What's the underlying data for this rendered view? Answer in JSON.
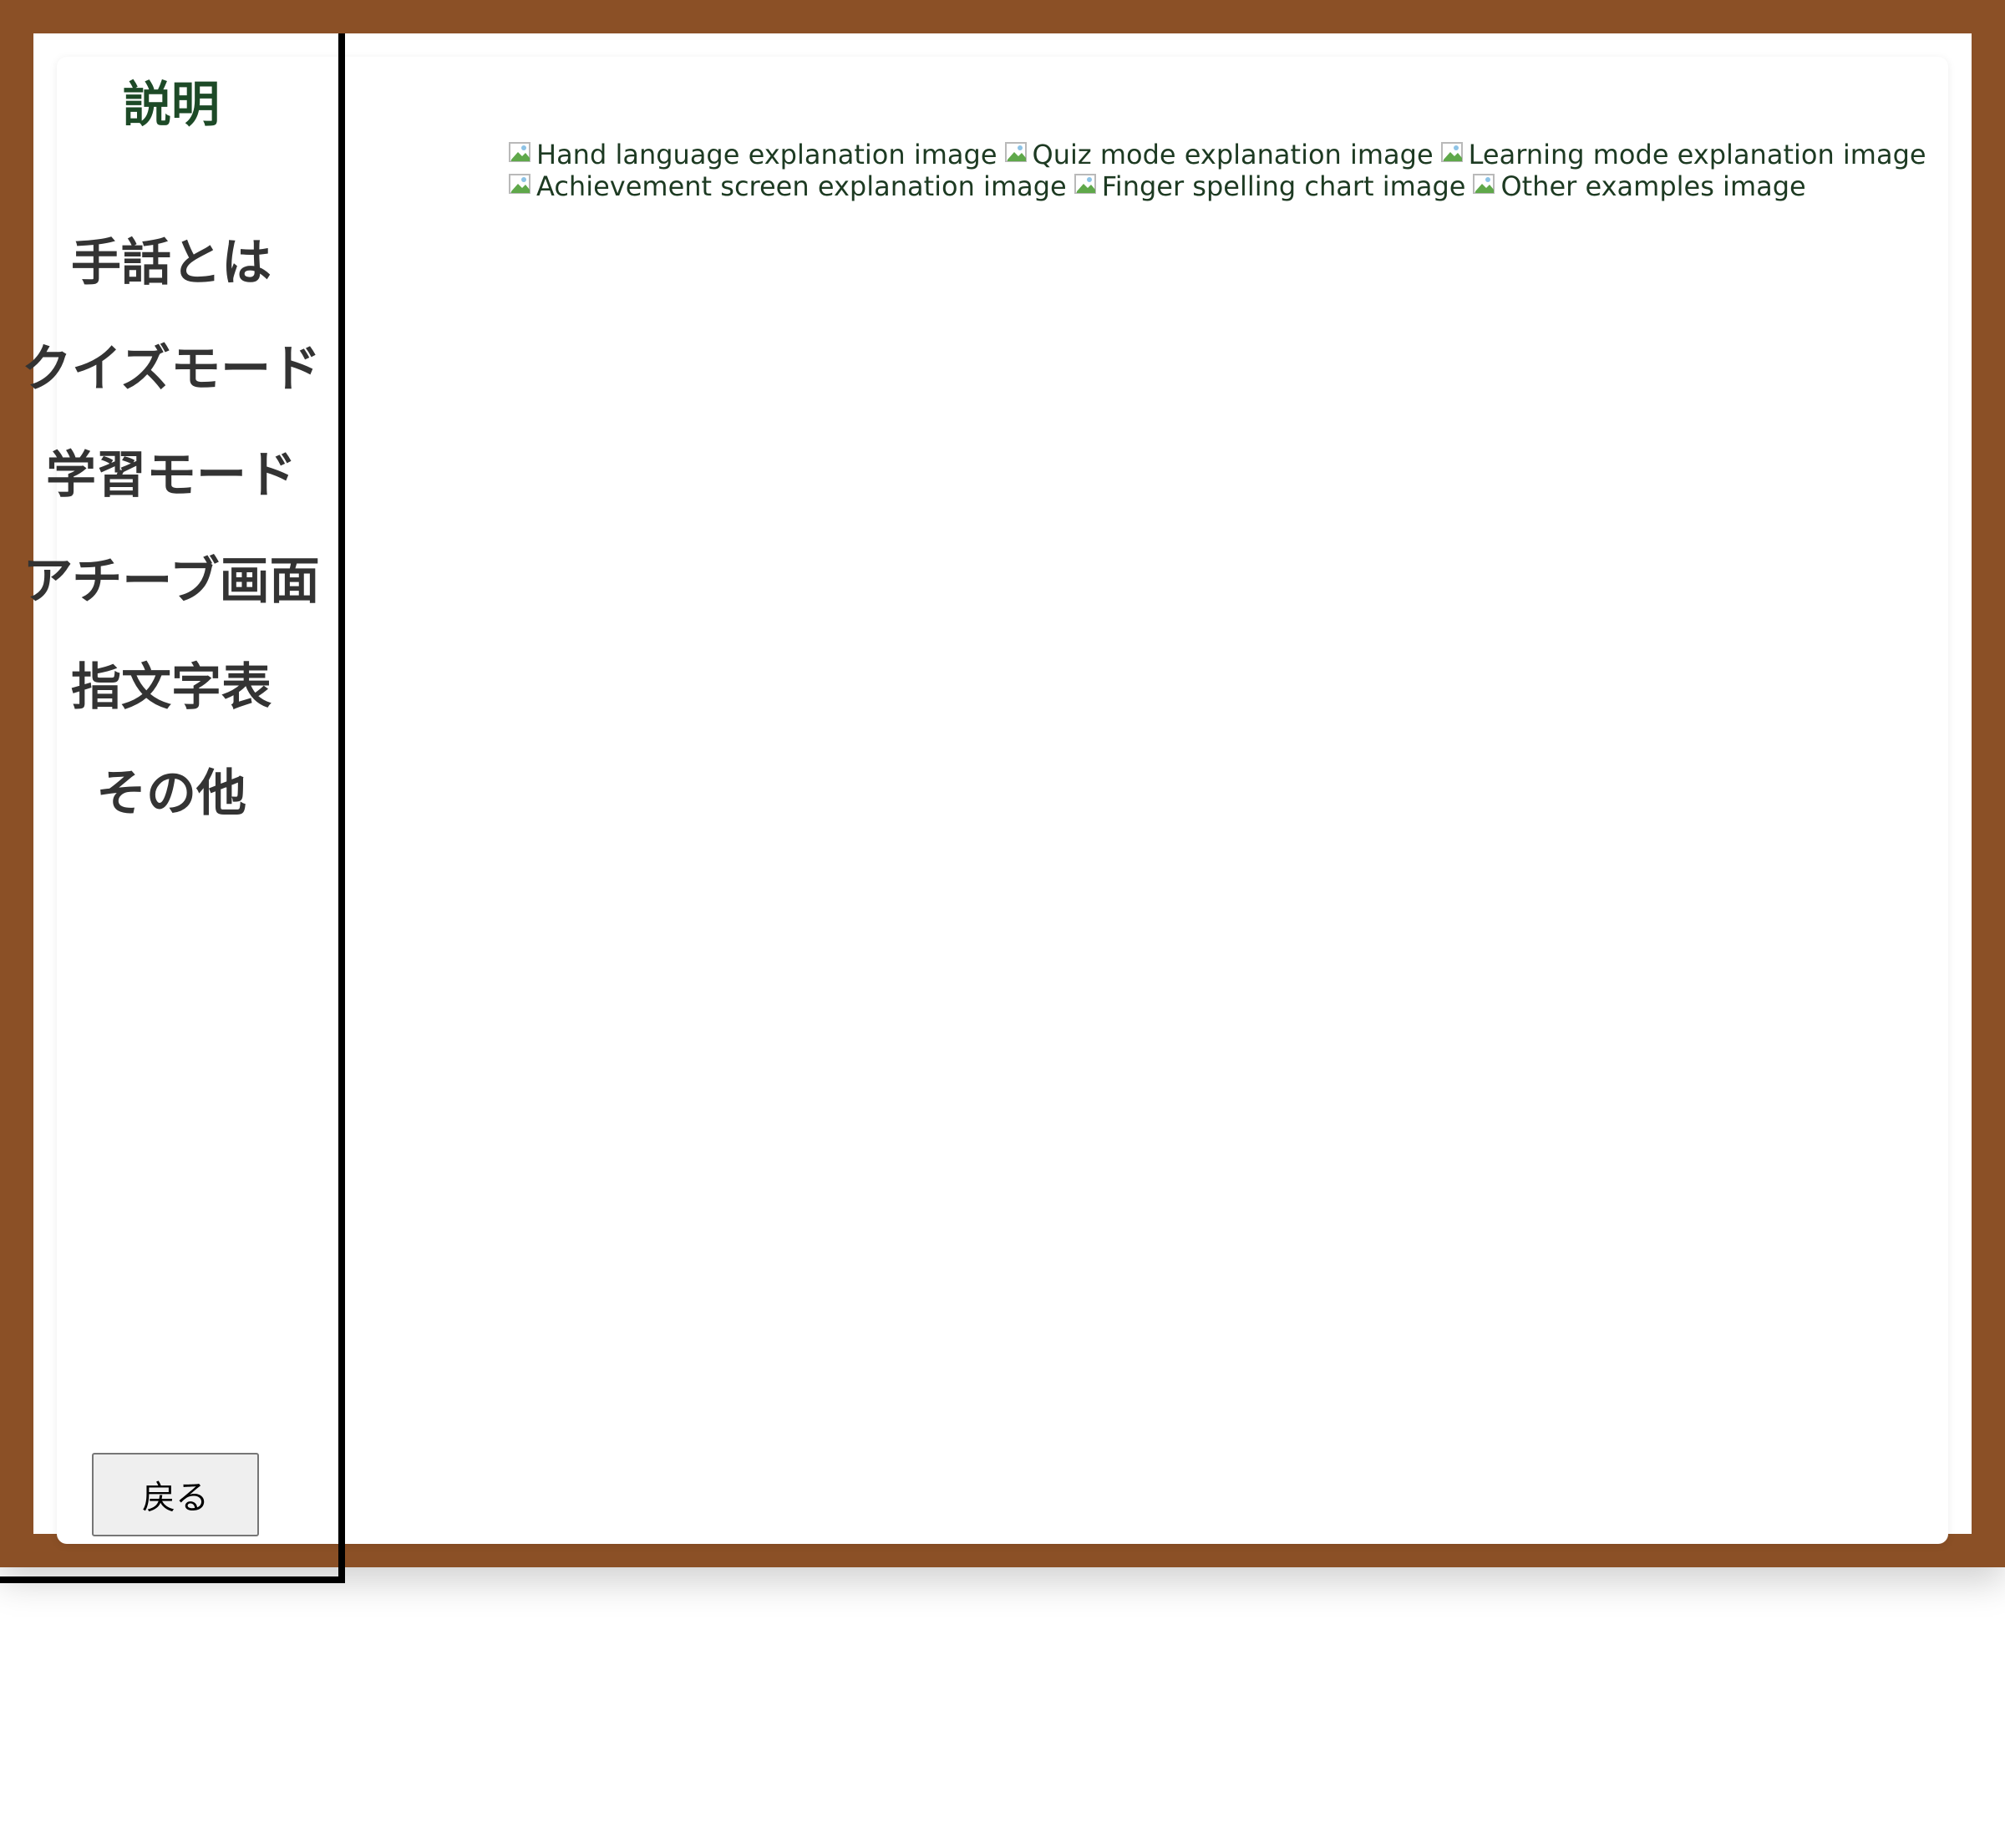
{
  "sidebar": {
    "title": "説明",
    "items": [
      {
        "label": "手話とは",
        "key": "sign-language"
      },
      {
        "label": "クイズモード",
        "key": "quiz-mode"
      },
      {
        "label": "学習モード",
        "key": "learning-mode"
      },
      {
        "label": "アチーブ画面",
        "key": "achieve-screen"
      },
      {
        "label": "指文字表",
        "key": "finger-spelling"
      },
      {
        "label": "その他",
        "key": "other"
      }
    ],
    "back_label": "戻る"
  },
  "content": {
    "images": [
      {
        "alt": "Hand language explanation image"
      },
      {
        "alt": "Quiz mode explanation image"
      },
      {
        "alt": "Learning mode explanation image"
      },
      {
        "alt": "Achievement screen explanation image"
      },
      {
        "alt": "Finger spelling chart image"
      },
      {
        "alt": "Other examples image"
      }
    ]
  },
  "colors": {
    "frame": "#8b5026",
    "title_green": "#1d4a27",
    "nav_text": "#333333"
  }
}
